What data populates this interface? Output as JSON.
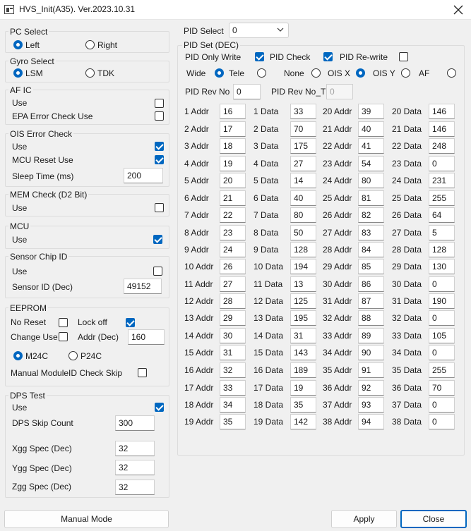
{
  "window": {
    "title": "HVS_Init(A35). Ver.2023.10.31"
  },
  "pc_select": {
    "title": "PC Select",
    "left": "Left",
    "right": "Right",
    "left_checked": true,
    "right_checked": false
  },
  "gyro_select": {
    "title": "Gyro Select",
    "lsm": "LSM",
    "tdk": "TDK",
    "lsm_checked": true,
    "tdk_checked": false
  },
  "af_ic": {
    "title": "AF IC",
    "use": "Use",
    "use_checked": false,
    "epa": "EPA Error Check Use",
    "epa_checked": false
  },
  "ois_error": {
    "title": "OIS Error Check",
    "use": "Use",
    "use_checked": true,
    "mcu_reset": "MCU Reset Use",
    "mcu_reset_checked": true,
    "sleep_label": "Sleep Time (ms)",
    "sleep_value": "200"
  },
  "mem_check": {
    "title": "MEM Check (D2 Bit)",
    "use": "Use",
    "use_checked": false
  },
  "mcu": {
    "title": "MCU",
    "use": "Use",
    "use_checked": true
  },
  "sensor_chip": {
    "title": "Sensor Chip ID",
    "use": "Use",
    "use_checked": false,
    "sensor_id_label": "Sensor ID (Dec)",
    "sensor_id_value": "49152"
  },
  "eeprom": {
    "title": "EEPROM",
    "no_reset": "No Reset",
    "no_reset_checked": false,
    "lock_off": "Lock off",
    "lock_off_checked": true,
    "change_use": "Change Use",
    "change_use_checked": false,
    "addr_label": "Addr (Dec)",
    "addr_value": "160",
    "m24c": "M24C",
    "m24c_checked": true,
    "p24c": "P24C",
    "p24c_checked": false,
    "manual_skip": "Manual ModuleID Check Skip",
    "manual_skip_checked": false
  },
  "dps_test": {
    "title": "DPS Test",
    "use": "Use",
    "use_checked": true,
    "skip_label": "DPS Skip Count",
    "skip_value": "300",
    "xgg_label": "Xgg Spec (Dec)",
    "xgg_value": "32",
    "ygg_label": "Ygg Spec (Dec)",
    "ygg_value": "32",
    "zgg_label": "Zgg Spec (Dec)",
    "zgg_value": "32"
  },
  "pid_select": {
    "label": "PID Select",
    "value": "0"
  },
  "pid_set": {
    "title": "PID Set (DEC)",
    "only_write": "PID Only Write",
    "only_write_checked": true,
    "pid_check": "PID Check",
    "pid_check_checked": true,
    "rewrite": "PID Re-write",
    "rewrite_checked": false,
    "wide": "Wide",
    "wide_checked": true,
    "tele": "Tele",
    "tele_checked": false,
    "none": "None",
    "none_checked": false,
    "ois_x": "OIS X",
    "ois_x_checked": true,
    "ois_y": "OIS Y",
    "ois_y_checked": false,
    "af": "AF",
    "af_checked": false,
    "rev_no_label": "PID Rev No",
    "rev_no_value": "0",
    "rev_no_t_label": "PID Rev No_T",
    "rev_no_t_value": "0",
    "rows_left": [
      {
        "addr_label": "1 Addr",
        "addr": "16",
        "data_label": "1 Data",
        "data": "33"
      },
      {
        "addr_label": "2 Addr",
        "addr": "17",
        "data_label": "2 Data",
        "data": "70"
      },
      {
        "addr_label": "3 Addr",
        "addr": "18",
        "data_label": "3 Data",
        "data": "175"
      },
      {
        "addr_label": "4 Addr",
        "addr": "19",
        "data_label": "4 Data",
        "data": "27"
      },
      {
        "addr_label": "5 Addr",
        "addr": "20",
        "data_label": "5 Data",
        "data": "14"
      },
      {
        "addr_label": "6 Addr",
        "addr": "21",
        "data_label": "6 Data",
        "data": "40"
      },
      {
        "addr_label": "7 Addr",
        "addr": "22",
        "data_label": "7 Data",
        "data": "80"
      },
      {
        "addr_label": "8 Addr",
        "addr": "23",
        "data_label": "8 Data",
        "data": "50"
      },
      {
        "addr_label": "9 Addr",
        "addr": "24",
        "data_label": "9 Data",
        "data": "128"
      },
      {
        "addr_label": "10 Addr",
        "addr": "26",
        "data_label": "10 Data",
        "data": "194"
      },
      {
        "addr_label": "11 Addr",
        "addr": "27",
        "data_label": "11 Data",
        "data": "13"
      },
      {
        "addr_label": "12 Addr",
        "addr": "28",
        "data_label": "12 Data",
        "data": "125"
      },
      {
        "addr_label": "13 Addr",
        "addr": "29",
        "data_label": "13 Data",
        "data": "195"
      },
      {
        "addr_label": "14 Addr",
        "addr": "30",
        "data_label": "14 Data",
        "data": "31"
      },
      {
        "addr_label": "15 Addr",
        "addr": "31",
        "data_label": "15 Data",
        "data": "143"
      },
      {
        "addr_label": "16 Addr",
        "addr": "32",
        "data_label": "16 Data",
        "data": "189"
      },
      {
        "addr_label": "17 Addr",
        "addr": "33",
        "data_label": "17 Data",
        "data": "19"
      },
      {
        "addr_label": "18 Addr",
        "addr": "34",
        "data_label": "18 Data",
        "data": "35"
      },
      {
        "addr_label": "19 Addr",
        "addr": "35",
        "data_label": "19 Data",
        "data": "142"
      }
    ],
    "rows_right": [
      {
        "addr_label": "20 Addr",
        "addr": "39",
        "data_label": "20 Data",
        "data": "146"
      },
      {
        "addr_label": "21 Addr",
        "addr": "40",
        "data_label": "21 Data",
        "data": "146"
      },
      {
        "addr_label": "22 Addr",
        "addr": "41",
        "data_label": "22 Data",
        "data": "248"
      },
      {
        "addr_label": "23 Addr",
        "addr": "54",
        "data_label": "23 Data",
        "data": "0"
      },
      {
        "addr_label": "24 Addr",
        "addr": "80",
        "data_label": "24 Data",
        "data": "231"
      },
      {
        "addr_label": "25 Addr",
        "addr": "81",
        "data_label": "25 Data",
        "data": "255"
      },
      {
        "addr_label": "26 Addr",
        "addr": "82",
        "data_label": "26 Data",
        "data": "64"
      },
      {
        "addr_label": "27 Addr",
        "addr": "83",
        "data_label": "27 Data",
        "data": "5"
      },
      {
        "addr_label": "28 Addr",
        "addr": "84",
        "data_label": "28 Data",
        "data": "128"
      },
      {
        "addr_label": "29 Addr",
        "addr": "85",
        "data_label": "29 Data",
        "data": "130"
      },
      {
        "addr_label": "30 Addr",
        "addr": "86",
        "data_label": "30 Data",
        "data": "0"
      },
      {
        "addr_label": "31 Addr",
        "addr": "87",
        "data_label": "31 Data",
        "data": "190"
      },
      {
        "addr_label": "32 Addr",
        "addr": "88",
        "data_label": "32 Data",
        "data": "0"
      },
      {
        "addr_label": "33 Addr",
        "addr": "89",
        "data_label": "33 Data",
        "data": "105"
      },
      {
        "addr_label": "34 Addr",
        "addr": "90",
        "data_label": "34 Data",
        "data": "0"
      },
      {
        "addr_label": "35 Addr",
        "addr": "91",
        "data_label": "35 Data",
        "data": "255"
      },
      {
        "addr_label": "36 Addr",
        "addr": "92",
        "data_label": "36 Data",
        "data": "70"
      },
      {
        "addr_label": "37 Addr",
        "addr": "93",
        "data_label": "37 Data",
        "data": "0"
      },
      {
        "addr_label": "38 Addr",
        "addr": "94",
        "data_label": "38 Data",
        "data": "0"
      }
    ]
  },
  "buttons": {
    "manual_mode": "Manual Mode",
    "apply": "Apply",
    "close": "Close"
  },
  "colors": {
    "accent": "#0067c0",
    "window_bg": "#f0f0f0",
    "border": "#dcdcdc"
  },
  "icons": {
    "title_app": "app-window-icon",
    "title_close": "close-icon",
    "dropdown": "chevron-down-icon"
  }
}
